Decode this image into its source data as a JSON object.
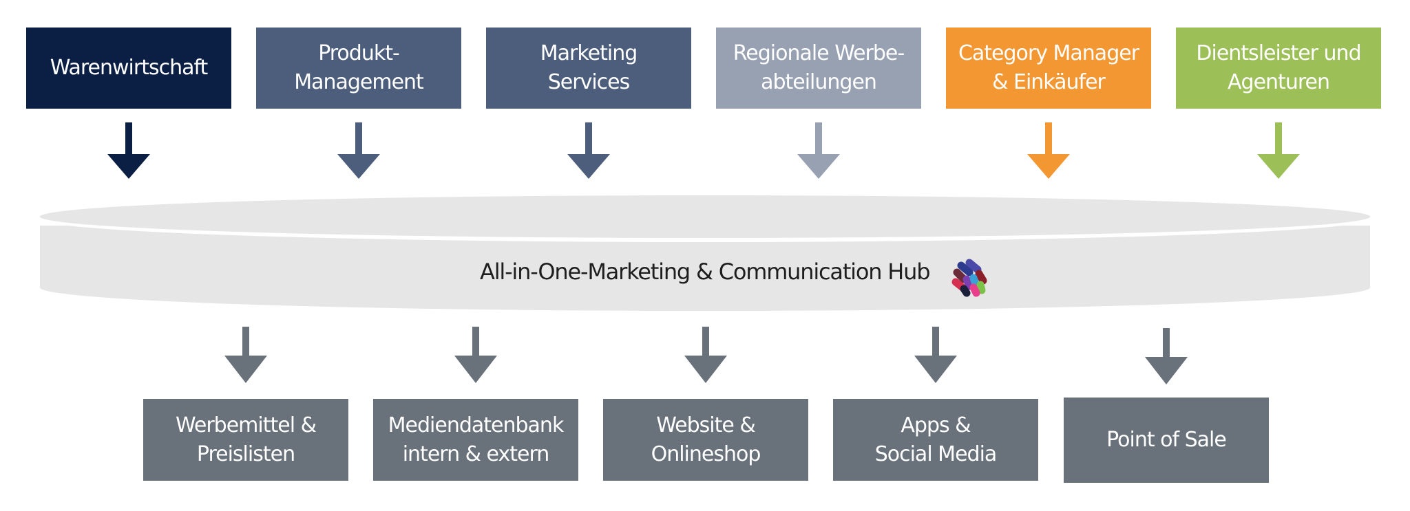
{
  "diagram": {
    "sources": [
      {
        "label": "Warenwirtschaft",
        "color": "#0b1f45"
      },
      {
        "label": "Produkt-\nManagement",
        "color": "#4c5e7b"
      },
      {
        "label": "Marketing\nServices",
        "color": "#4c5e7b"
      },
      {
        "label": "Regionale Werbe-\nabteilungen",
        "color": "#97a1b2"
      },
      {
        "label": "Category Manager\n& Einkäufer",
        "color": "#f39733"
      },
      {
        "label": "Dientsleister und\nAgenturen",
        "color": "#9cbf57"
      }
    ],
    "hub": {
      "label": "All-in-One-Marketing & Communication Hub",
      "logo_icon": "molecule-network-icon",
      "color": "#e6e6e6"
    },
    "outputs": [
      {
        "label": "Werbemittel &\nPreislisten"
      },
      {
        "label": "Mediendatenbank\nintern & extern"
      },
      {
        "label": "Website &\nOnlineshop"
      },
      {
        "label": "Apps &\nSocial Media"
      },
      {
        "label": "Point of Sale"
      }
    ],
    "output_color": "#69717a",
    "output_arrow_color": "#69717a"
  }
}
